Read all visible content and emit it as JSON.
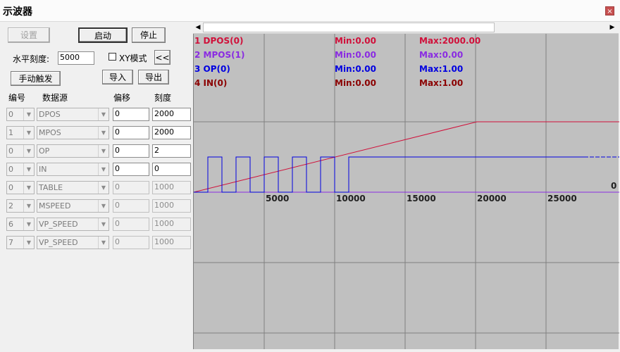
{
  "window": {
    "title": "示波器",
    "close_glyph": "×"
  },
  "toolbar": {
    "settings_label": "设置",
    "start_label": "启动",
    "stop_label": "停止",
    "hscale_label": "水平刻度:",
    "hscale_value": "5000",
    "xy_mode_label": "XY模式",
    "collapse_label": "<<",
    "manual_trigger_label": "手动触发",
    "import_label": "导入",
    "export_label": "导出"
  },
  "table": {
    "headers": {
      "index": "编号",
      "source": "数据源",
      "offset": "偏移",
      "scale": "刻度"
    },
    "rows": [
      {
        "index": "0",
        "source": "DPOS",
        "offset": "0",
        "scale": "2000",
        "enabled": true
      },
      {
        "index": "1",
        "source": "MPOS",
        "offset": "0",
        "scale": "2000",
        "enabled": true
      },
      {
        "index": "0",
        "source": "OP",
        "offset": "0",
        "scale": "2",
        "enabled": true
      },
      {
        "index": "0",
        "source": "IN",
        "offset": "0",
        "scale": "0",
        "enabled": true
      },
      {
        "index": "0",
        "source": "TABLE",
        "offset": "0",
        "scale": "1000",
        "enabled": false
      },
      {
        "index": "2",
        "source": "MSPEED",
        "offset": "0",
        "scale": "1000",
        "enabled": false
      },
      {
        "index": "6",
        "source": "VP_SPEED",
        "offset": "0",
        "scale": "1000",
        "enabled": false
      },
      {
        "index": "7",
        "source": "VP_SPEED",
        "offset": "0",
        "scale": "1000",
        "enabled": false
      }
    ]
  },
  "scope": {
    "colors": {
      "grid": "#808080",
      "bg": "#c0c0c0",
      "dpos": "#d0103a",
      "mpos": "#8a2be2",
      "op": "#0000e0",
      "in": "#8b0000",
      "axis_text": "#202020"
    },
    "channels": [
      {
        "label": "1 DPOS(0)",
        "min": "Min:0.00",
        "max": "Max:2000.00",
        "color": "#d0103a"
      },
      {
        "label": "2 MPOS(1)",
        "min": "Min:0.00",
        "max": "Max:0.00",
        "color": "#8a2be2"
      },
      {
        "label": "3 OP(0)",
        "min": "Min:0.00",
        "max": "Max:1.00",
        "color": "#0000e0"
      },
      {
        "label": "4 IN(0)",
        "min": "Min:0.00",
        "max": "Max:1.00",
        "color": "#8b0000"
      }
    ],
    "x_ticks": [
      "5000",
      "10000",
      "15000",
      "20000",
      "25000"
    ],
    "right_label": "0"
  }
}
